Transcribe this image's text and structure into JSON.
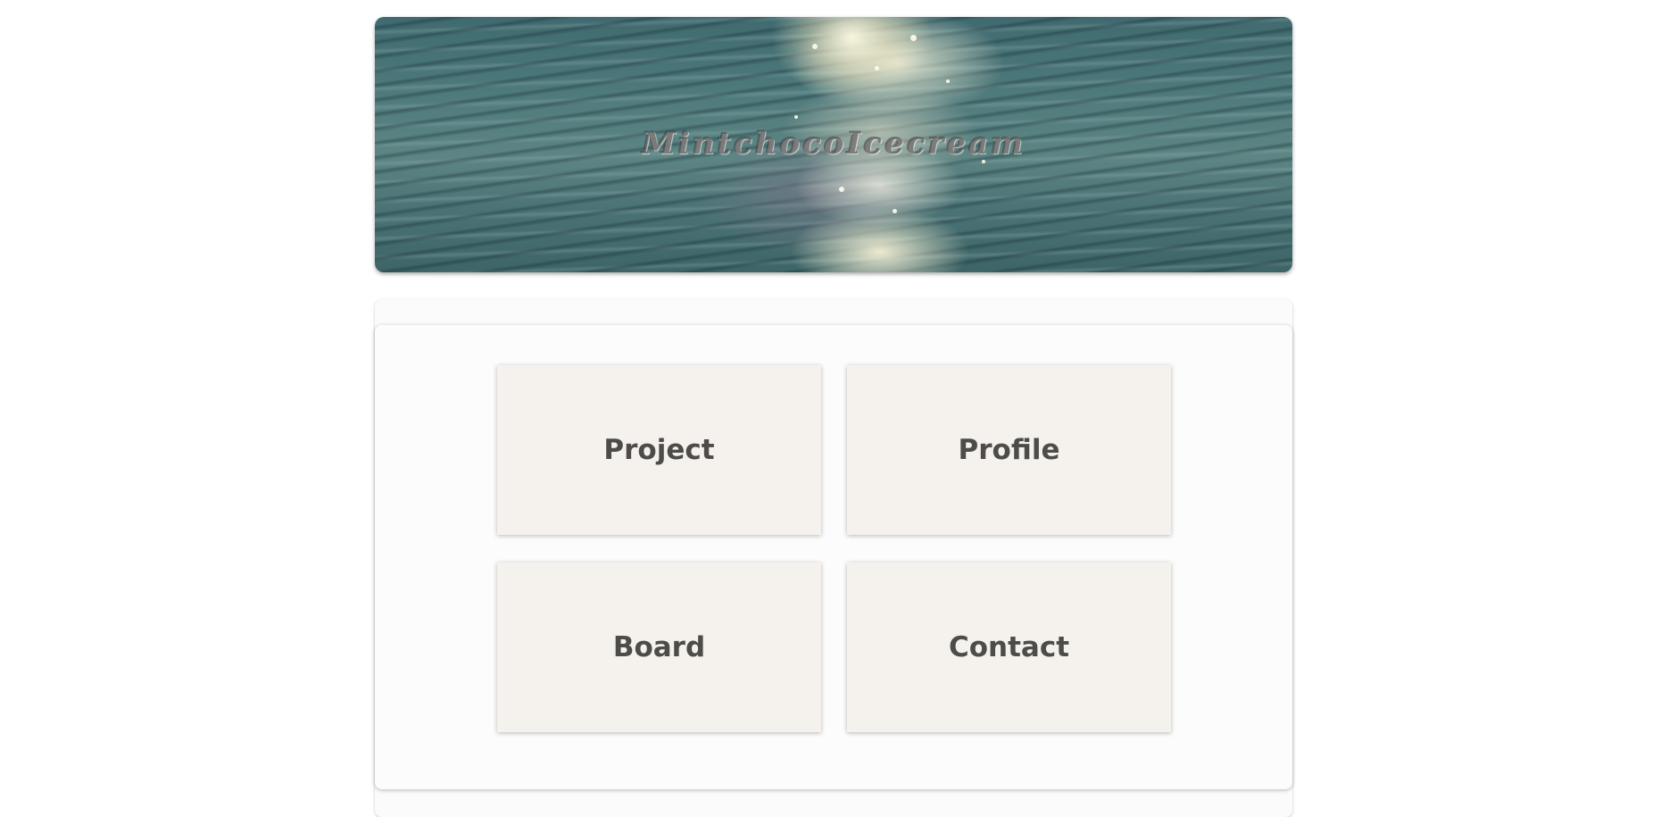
{
  "header": {
    "title": "MintchocoIcecream"
  },
  "menu": {
    "items": [
      {
        "label": "Project"
      },
      {
        "label": "Profile"
      },
      {
        "label": "Board"
      },
      {
        "label": "Contact"
      }
    ]
  },
  "colors": {
    "page_background": "#ffffff",
    "panel_background": "#fcfcfc",
    "tile_background": "#f5f2ee",
    "tile_text": "#4e4c49",
    "banner_water": "#4f7a7c"
  }
}
